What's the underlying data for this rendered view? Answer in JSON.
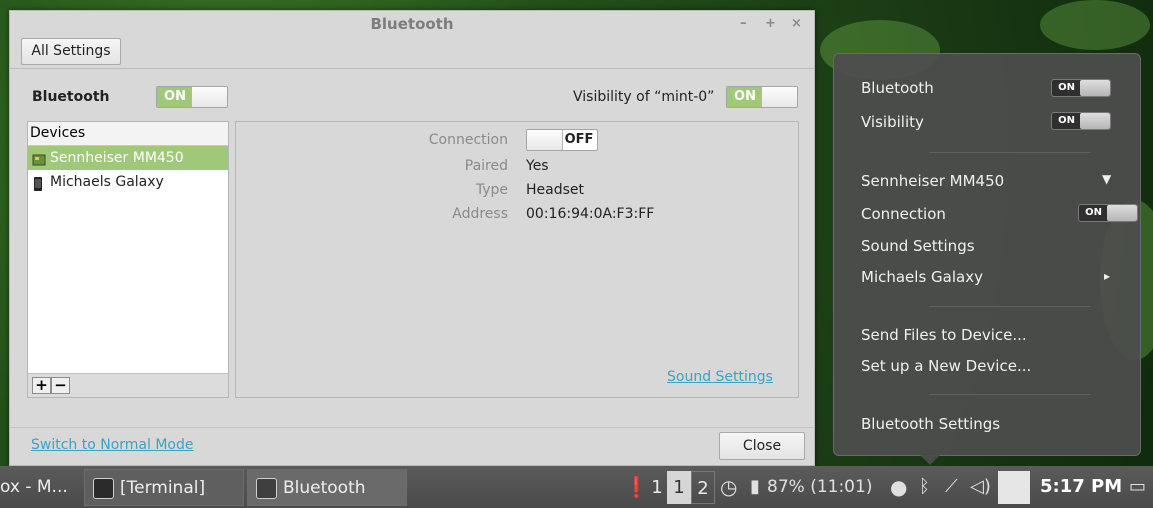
{
  "window": {
    "title": "Bluetooth",
    "controls": {
      "minimize": "–",
      "maximize": "+",
      "close": "×"
    },
    "all_settings": "All Settings",
    "bluetooth_label": "Bluetooth",
    "bluetooth_state": "ON",
    "visibility_label": "Visibility of “mint-0”",
    "visibility_state": "ON",
    "devices_header": "Devices",
    "devices": [
      {
        "name": "Sennheiser MM450",
        "icon": "headset-icon",
        "selected": true
      },
      {
        "name": "Michaels Galaxy",
        "icon": "phone-icon",
        "selected": false
      }
    ],
    "add_symbol": "+",
    "remove_symbol": "−",
    "details": {
      "connection_label": "Connection",
      "connection_state": "OFF",
      "paired_label": "Paired",
      "paired_value": "Yes",
      "type_label": "Type",
      "type_value": "Headset",
      "address_label": "Address",
      "address_value": "00:16:94:0A:F3:FF",
      "sound_settings": "Sound Settings"
    },
    "switch_mode": "Switch to Normal Mode",
    "close": "Close"
  },
  "popup": {
    "bluetooth": "Bluetooth",
    "bluetooth_state": "ON",
    "visibility": "Visibility",
    "visibility_state": "ON",
    "device1": "Sennheiser MM450",
    "device1_arrow": "▼",
    "connection": "Connection",
    "connection_state": "ON",
    "sound_settings": "Sound Settings",
    "device2": "Michaels Galaxy",
    "device2_arrow": "▸",
    "send_files": "Send Files to Device...",
    "setup_device": "Set up a New Device...",
    "bt_settings": "Bluetooth Settings"
  },
  "taskbar": {
    "task_partial": "ox - M...",
    "task_terminal": "[Terminal]",
    "task_bluetooth": "Bluetooth",
    "ws1": "1",
    "ws_active": "1",
    "ws2": "2",
    "battery": "87% (11:01)",
    "time": "5:17 PM"
  },
  "colors": {
    "accent_green": "#9fc978",
    "link_blue": "#3aa3c2",
    "panel_bg": "#d8d8d8"
  }
}
